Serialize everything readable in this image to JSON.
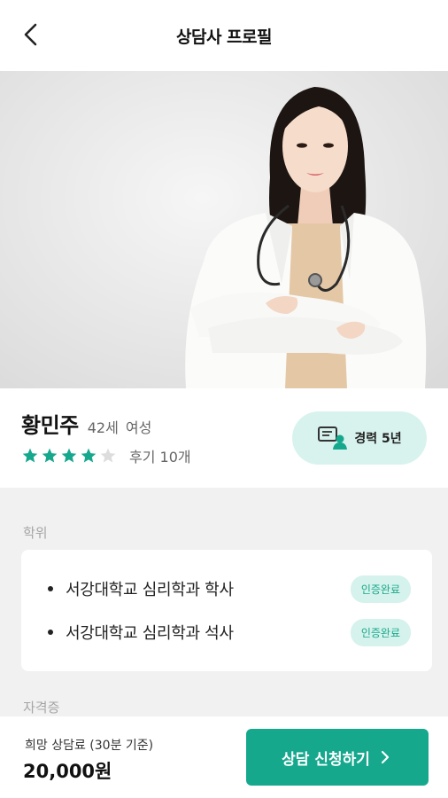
{
  "header": {
    "title": "상담사 프로필"
  },
  "profile": {
    "name": "황민주",
    "age": "42세",
    "gender": "여성",
    "rating": 4,
    "rating_max": 5,
    "reviews": "후기 10개",
    "career": "경력 5년"
  },
  "sections": {
    "degree_label": "학위",
    "license_label": "자격증"
  },
  "degrees": [
    {
      "text": "서강대학교 심리학과 학사",
      "status": "인증완료"
    },
    {
      "text": "서강대학교 심리학과 석사",
      "status": "인증완료"
    }
  ],
  "bottom": {
    "fee_label": "희망 상담료 (30분 기준)",
    "fee_value": "20,000원",
    "apply_label": "상담 신청하기"
  },
  "colors": {
    "accent": "#16a88d",
    "accent_light": "#d8f3ee",
    "star_on": "#16a88d",
    "star_off": "#dddddd"
  },
  "icons": {
    "back": "chevron-left-icon",
    "career": "chat-person-icon",
    "apply": "chevron-right-icon",
    "star": "star-icon"
  }
}
